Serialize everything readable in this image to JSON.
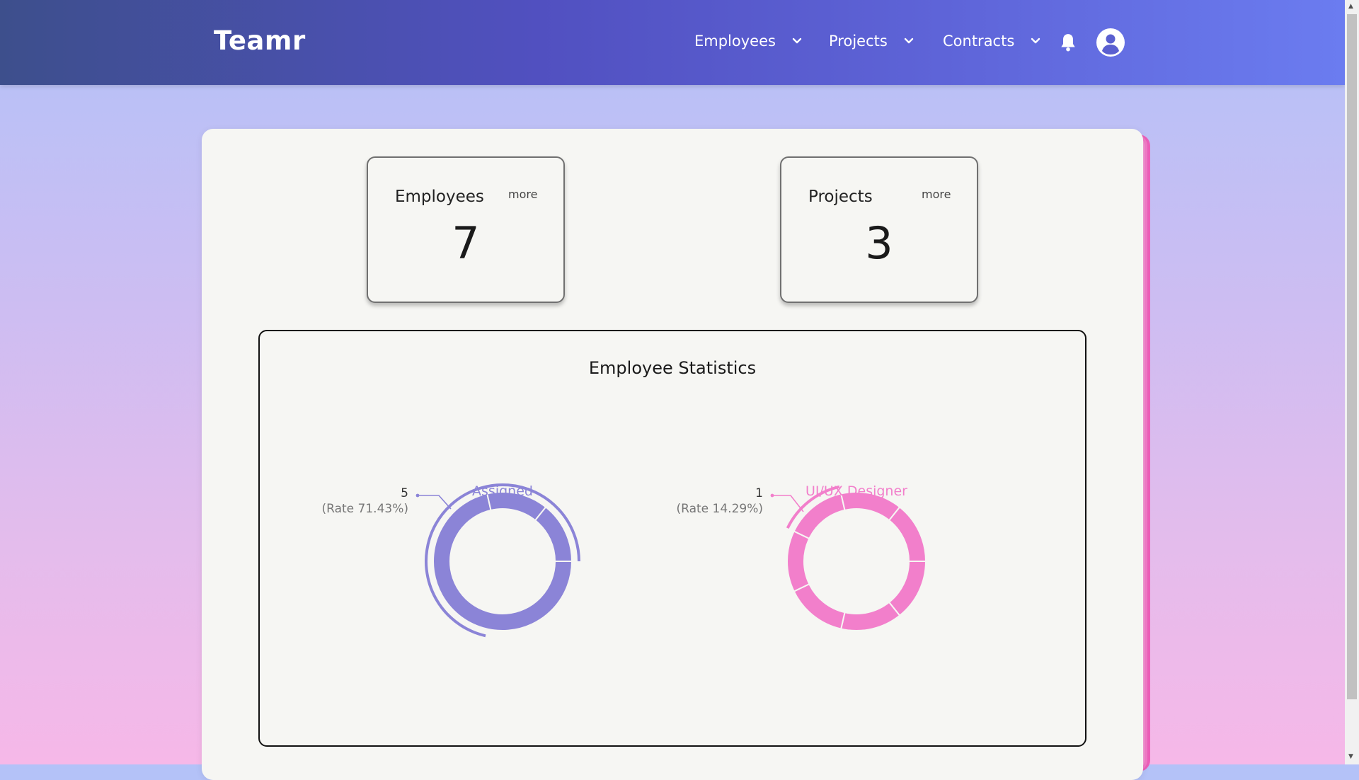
{
  "brand": "Teamr",
  "nav": {
    "employees": "Employees",
    "projects": "Projects",
    "contracts": "Contracts"
  },
  "icons": {
    "chevron": "chevron-down-icon",
    "bell": "bell-icon",
    "avatar": "user-circle-icon"
  },
  "cards": {
    "employees": {
      "title": "Employees",
      "more": "more",
      "value": "7"
    },
    "projects": {
      "title": "Projects",
      "more": "more",
      "value": "3"
    }
  },
  "stats": {
    "title": "Employee Statistics",
    "charts": {
      "assigned": {
        "center_label": "Assigned",
        "count": "5",
        "rate": "(Rate 71.43%)",
        "color": "#8b84d7"
      },
      "designer": {
        "center_label": "UI/UX Designer",
        "count": "1",
        "rate": "(Rate 14.29%)",
        "color": "#f27fcb"
      }
    }
  },
  "colors": {
    "nav_start": "#3d4f8c",
    "nav_end": "#6b7cf0",
    "assigned": "#8b84d7",
    "designer": "#f27fcb"
  },
  "chart_data": [
    {
      "type": "pie",
      "center_label": "Assigned",
      "highlighted": {
        "value": 5,
        "label": "(Rate 71.43%)"
      },
      "segments": [
        5,
        1,
        1
      ]
    },
    {
      "type": "pie",
      "center_label": "UI/UX Designer",
      "highlighted": {
        "value": 1,
        "label": "(Rate 14.29%)"
      },
      "segments": [
        1,
        1,
        1,
        1,
        1,
        1,
        1
      ]
    }
  ]
}
